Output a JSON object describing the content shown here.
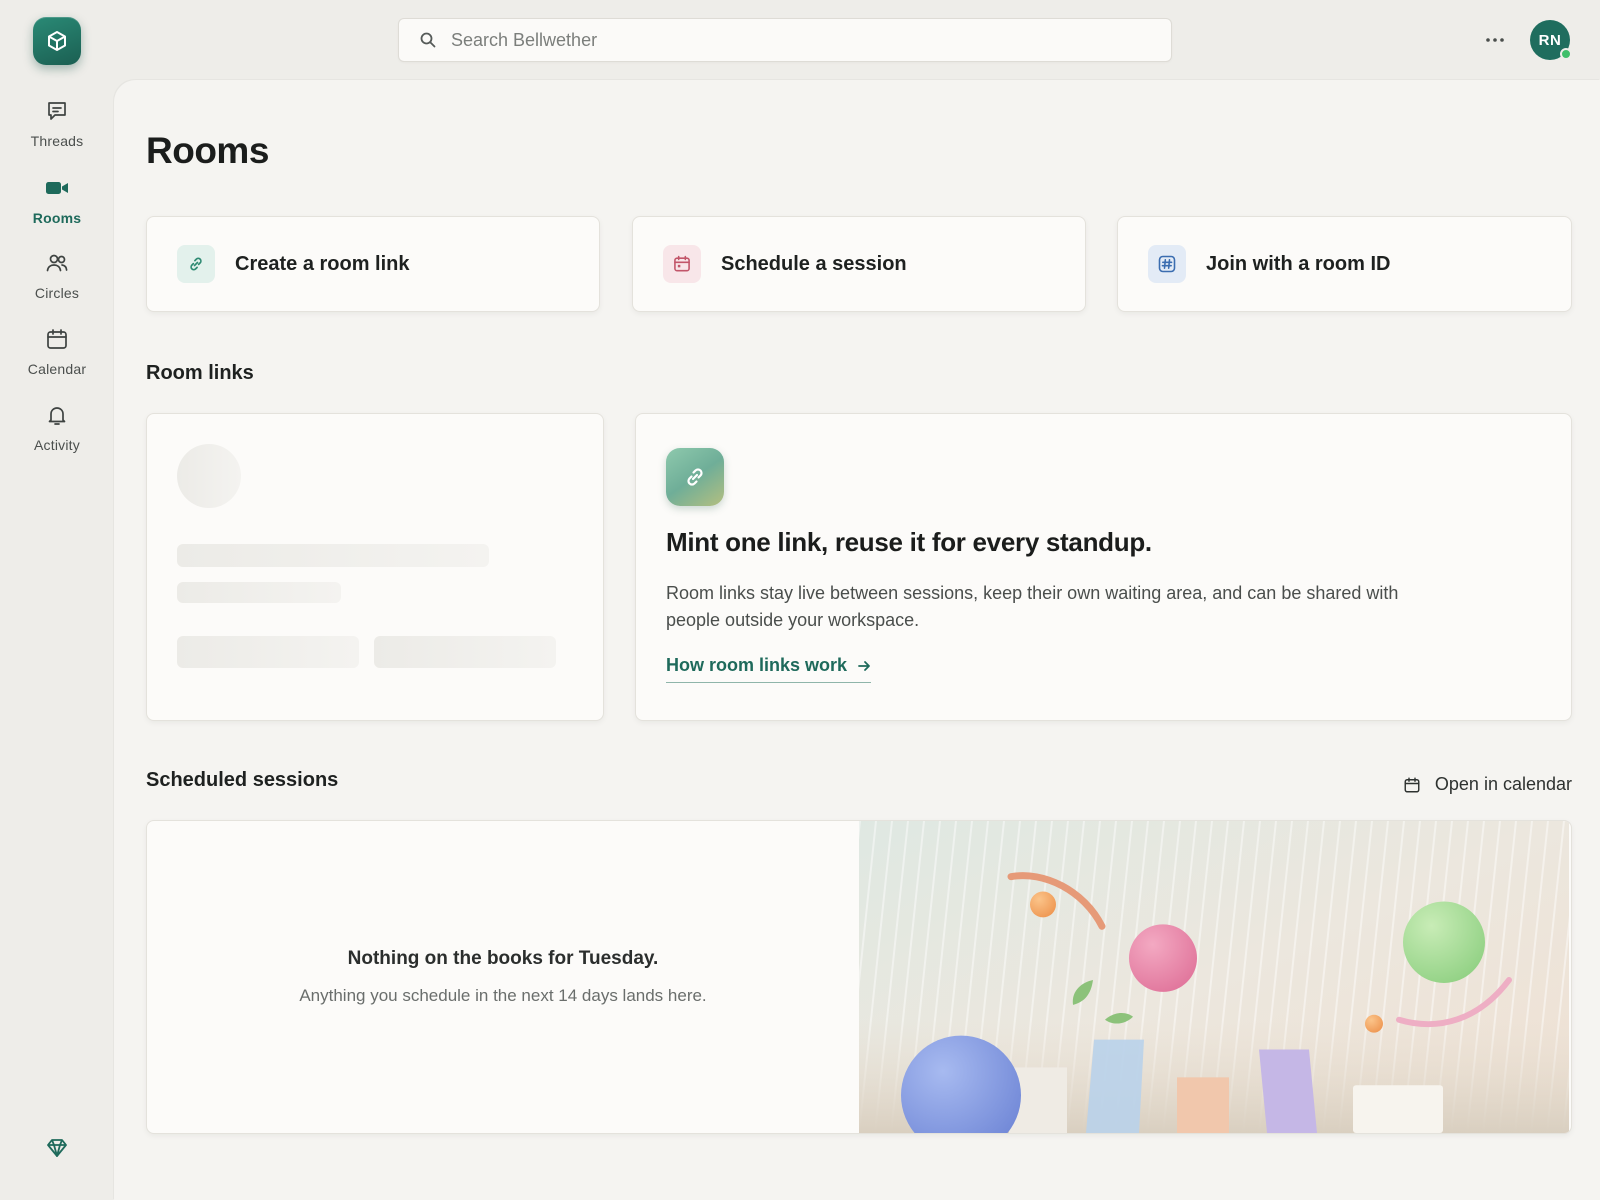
{
  "app": {
    "logo_icon": "cube-icon",
    "colors": {
      "brand": "#1f6d5e",
      "accent_link": "#1e6a5b",
      "presence": "#3fbf6a"
    }
  },
  "sidebar": {
    "items": [
      {
        "id": "threads",
        "label": "Threads",
        "icon": "chat-icon",
        "active": false
      },
      {
        "id": "rooms",
        "label": "Rooms",
        "icon": "video-camera-icon",
        "active": true
      },
      {
        "id": "circles",
        "label": "Circles",
        "icon": "people-icon",
        "active": false
      },
      {
        "id": "calendar",
        "label": "Calendar",
        "icon": "calendar-icon",
        "active": false
      },
      {
        "id": "activity",
        "label": "Activity",
        "icon": "bell-icon",
        "active": false
      }
    ],
    "footer_icon": "gem-icon"
  },
  "header": {
    "search_placeholder": "Search Bellwether",
    "more_icon": "ellipsis-icon",
    "avatar_initials": "RN"
  },
  "page": {
    "title": "Rooms"
  },
  "actions": [
    {
      "label": "Create a room link",
      "icon": "link-icon",
      "tint": "#e3f1ec"
    },
    {
      "label": "Schedule a session",
      "icon": "calendar-icon",
      "tint": "#f8e6e9"
    },
    {
      "label": "Join with a room ID",
      "icon": "hash-icon",
      "tint": "#e3ebf6"
    }
  ],
  "room_links": {
    "title": "Room links",
    "promo": {
      "icon": "link-icon",
      "title": "Mint one link, reuse it for every standup.",
      "body": "Room links stay live between sessions, keep their own waiting area, and can be shared with people outside your workspace.",
      "link_label": "How room links work"
    }
  },
  "sessions": {
    "title": "Scheduled sessions",
    "open_calendar_label": "Open in calendar",
    "empty_title": "Nothing on the books for Tuesday.",
    "empty_subtitle": "Anything you schedule in the next 14 days lands here."
  }
}
